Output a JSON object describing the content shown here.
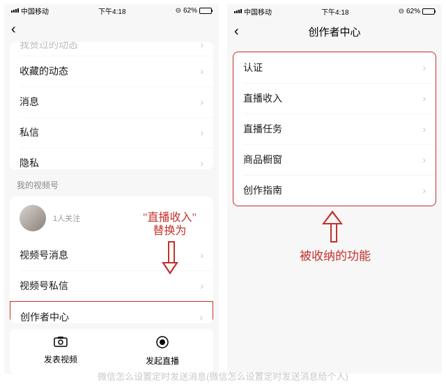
{
  "status": {
    "carrier": "中国移动",
    "time": "下午4:18",
    "battery_pct": "62%"
  },
  "left": {
    "section1": {
      "cutoff": "我赞过的动态",
      "items": [
        "收藏的动态",
        "消息",
        "私信",
        "隐私"
      ]
    },
    "section2_title": "我的视频号",
    "follow": "1人关注",
    "section2_items": [
      "视频号消息",
      "视频号私信",
      "创作者中心"
    ],
    "actions": {
      "left": "发表视频",
      "right": "发起直播"
    }
  },
  "right": {
    "title": "创作者中心",
    "items": [
      "认证",
      "直播收入",
      "直播任务",
      "商品橱窗",
      "创作指南"
    ]
  },
  "annotations": {
    "replace_prefix": "\"直播收入\"",
    "replace_suffix": "替换为",
    "collapsed": "被收纳的功能"
  },
  "caption": "微信怎么设置定时发送消息(微信怎么设置定时发送消息给个人)",
  "colors": {
    "highlight": "#c4302b"
  }
}
